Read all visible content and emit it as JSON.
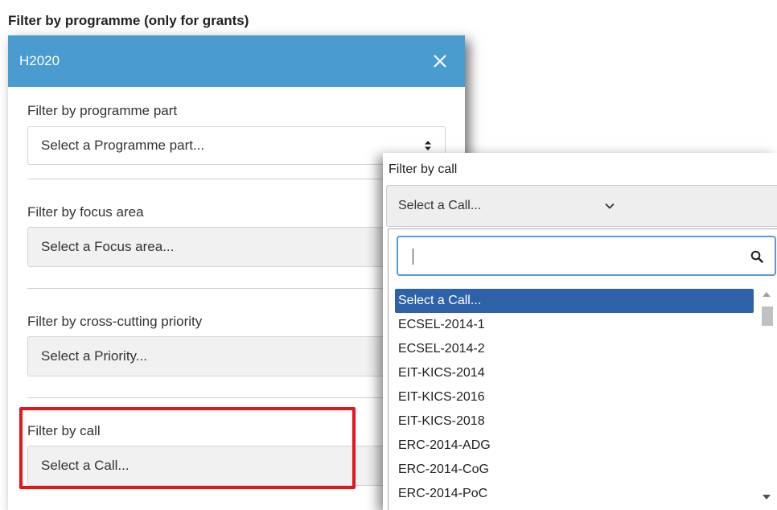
{
  "left": {
    "title": "Filter by programme (only for grants)",
    "programme": {
      "name": "H2020",
      "close_icon": "close-icon"
    },
    "filters": [
      {
        "label": "Filter by programme part",
        "placeholder": "Select a Programme part..."
      },
      {
        "label": "Filter by focus area",
        "placeholder": "Select a Focus area..."
      },
      {
        "label": "Filter by cross-cutting priority",
        "placeholder": "Select a Priority..."
      },
      {
        "label": "Filter by call",
        "placeholder": "Select a Call..."
      }
    ],
    "highlight_color": "#e8141c",
    "header_color": "#4a9bd0"
  },
  "right": {
    "title": "Filter by call",
    "select_value": "Select a Call...",
    "search": {
      "value": "",
      "icon": "search-icon"
    },
    "options": [
      "Select a Call...",
      "ECSEL-2014-1",
      "ECSEL-2014-2",
      "EIT-KICS-2014",
      "EIT-KICS-2016",
      "EIT-KICS-2018",
      "ERC-2014-ADG",
      "ERC-2014-CoG",
      "ERC-2014-PoC"
    ],
    "selected_option": "Select a Call...",
    "selected_color": "#2e62a8"
  }
}
